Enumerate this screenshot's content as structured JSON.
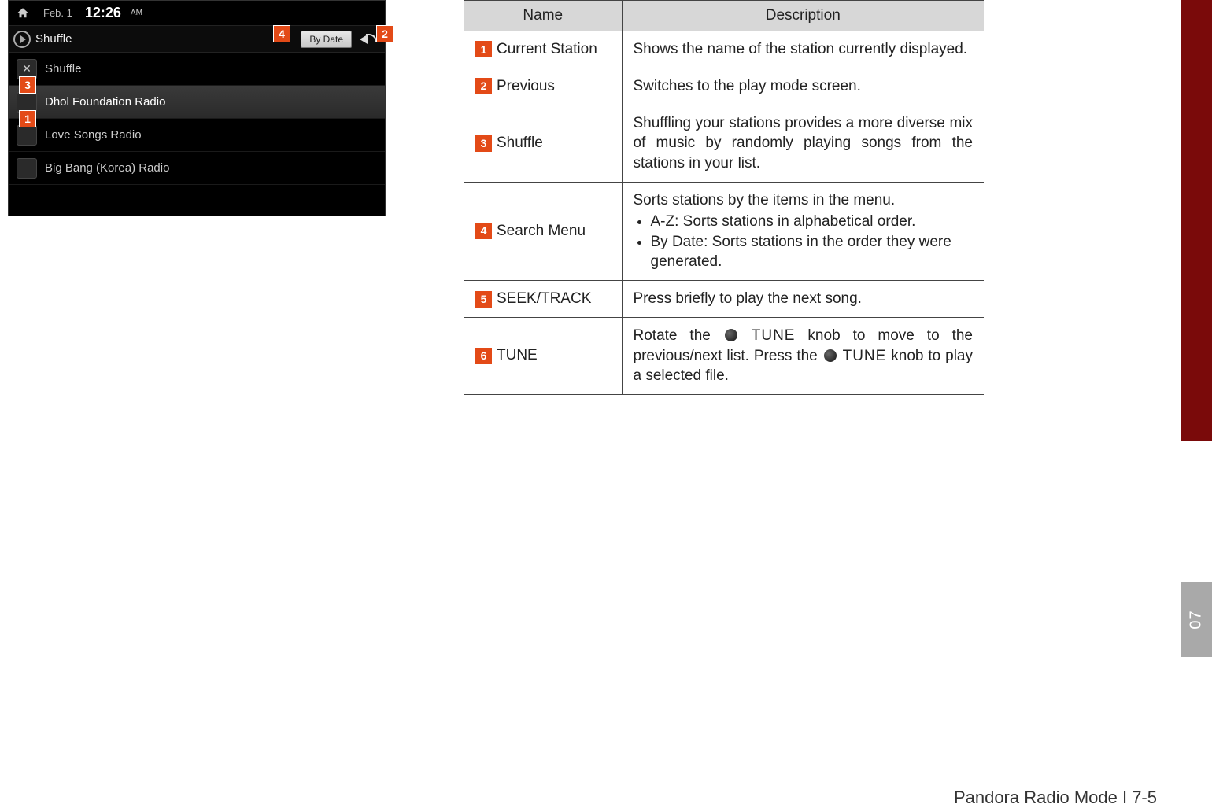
{
  "screenshot": {
    "status": {
      "date": "Feb. 1",
      "time": "12:26",
      "ampm": "AM"
    },
    "titlebar": {
      "title": "Shuffle",
      "sort_button": "By Date"
    },
    "rows": {
      "shuffle": "Shuffle",
      "station1": "Dhol Foundation Radio",
      "station2": "Love Songs Radio",
      "station3": "Big Bang (Korea) Radio"
    },
    "callouts": {
      "c1": "1",
      "c2": "2",
      "c3": "3",
      "c4": "4"
    }
  },
  "table": {
    "head": {
      "name": "Name",
      "desc": "Description"
    },
    "rows": {
      "r1": {
        "num": "1",
        "name": "Current Station",
        "desc": "Shows the name of the station currently displayed."
      },
      "r2": {
        "num": "2",
        "name": "Previous",
        "desc": "Switches to the play mode screen."
      },
      "r3": {
        "num": "3",
        "name": "Shuffle",
        "desc": "Shuffling your stations provides a more diverse mix of music by randomly playing songs from the stations in your list."
      },
      "r4": {
        "num": "4",
        "name": "Search Menu",
        "intro": "Sorts stations by the items in the menu.",
        "b1": "A-Z: Sorts stations in alphabetical order.",
        "b2": "By Date: Sorts stations in the order they were generated."
      },
      "r5": {
        "num": "5",
        "name": "SEEK/TRACK",
        "desc": "Press briefly to play the next song."
      },
      "r6": {
        "num": "6",
        "name": "TUNE",
        "pre1": "Rotate the ",
        "t1": "TUNE",
        "mid": " knob to move to the previous/next list. Press the ",
        "t2": "TUNE",
        "post": " knob to play a selected file."
      }
    }
  },
  "sidetab": "07",
  "footer": "Pandora Radio Mode I 7-5"
}
